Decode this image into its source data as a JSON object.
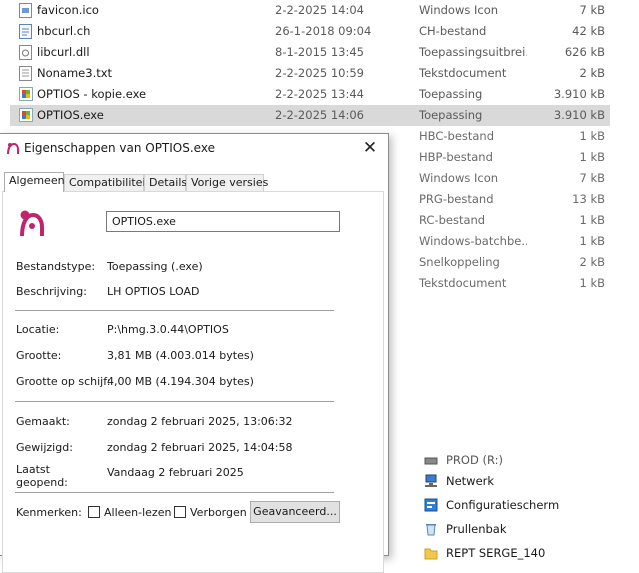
{
  "files": [
    {
      "name": "favicon.ico",
      "date": "2-2-2025 14:04",
      "type": "Windows Icon",
      "size": "7 kB",
      "icon": "icon-file-icon"
    },
    {
      "name": "hbcurl.ch",
      "date": "26-1-2018 09:04",
      "type": "CH-bestand",
      "size": "42 kB",
      "icon": "file-icon"
    },
    {
      "name": "libcurl.dll",
      "date": "8-1-2015 13:45",
      "type": "Toepassingsuitbrei...",
      "size": "626 kB",
      "icon": "dll-file-icon"
    },
    {
      "name": "Noname3.txt",
      "date": "2-2-2025 10:59",
      "type": "Tekstdocument",
      "size": "2 kB",
      "icon": "text-file-icon"
    },
    {
      "name": "OPTIOS - kopie.exe",
      "date": "2-2-2025 13:44",
      "type": "Toepassing",
      "size": "3.910 kB",
      "icon": "exe-icon"
    },
    {
      "name": "OPTIOS.exe",
      "date": "2-2-2025 14:06",
      "type": "Toepassing",
      "size": "3.910 kB",
      "icon": "exe-icon",
      "selected": true
    }
  ],
  "file_rows_partial": [
    {
      "type": "HBC-bestand",
      "size": "1 kB"
    },
    {
      "type": "HBP-bestand",
      "size": "1 kB"
    },
    {
      "type": "Windows Icon",
      "size": "7 kB"
    },
    {
      "type": "PRG-bestand",
      "size": "13 kB"
    },
    {
      "type": "RC-bestand",
      "size": "1 kB"
    },
    {
      "type": "Windows-batchbe...",
      "size": "1 kB"
    },
    {
      "type": "Snelkoppeling",
      "size": "2 kB"
    },
    {
      "type": "Tekstdocument",
      "size": "1 kB"
    }
  ],
  "nav_items": [
    {
      "label": "PROD (R:)",
      "icon": "drive-icon"
    },
    {
      "label": "Netwerk",
      "icon": "network-icon"
    },
    {
      "label": "Configuratiescherm",
      "icon": "control-panel-icon"
    },
    {
      "label": "Prullenbak",
      "icon": "recycle-bin-icon"
    },
    {
      "label": "REPT SERGE_140",
      "icon": "folder-icon"
    }
  ],
  "dialog": {
    "title": "Eigenschappen van OPTIOS.exe",
    "close_label": "✕",
    "tabs": [
      "Algemeen",
      "Compatibiliteit",
      "Details",
      "Vorige versies"
    ],
    "filename": "OPTIOS.exe",
    "fields": {
      "type_label": "Bestandstype:",
      "type_value": "Toepassing (.exe)",
      "desc_label": "Beschrijving:",
      "desc_value": "LH OPTIOS LOAD",
      "loc_label": "Locatie:",
      "loc_value": "P:\\hmg.3.0.44\\OPTIOS",
      "size_label": "Grootte:",
      "size_value": "3,81 MB (4.003.014 bytes)",
      "disk_label": "Grootte op schijf:",
      "disk_value": "4,00 MB (4.194.304 bytes)",
      "created_label": "Gemaakt:",
      "created_value": "zondag 2 februari 2025, 13:06:32",
      "modified_label": "Gewijzigd:",
      "modified_value": "zondag 2 februari 2025, 14:04:58",
      "opened_label_1": "Laatst",
      "opened_label_2": "geopend:",
      "opened_value": "Vandaag 2 februari 2025",
      "attr_label": "Kenmerken:",
      "readonly_label": "Alleen-lezen",
      "hidden_label": "Verborgen",
      "advanced_label": "Geavanceerd..."
    }
  },
  "colors": {
    "selection": "#d9d9d9",
    "accent": "#c0246d"
  }
}
